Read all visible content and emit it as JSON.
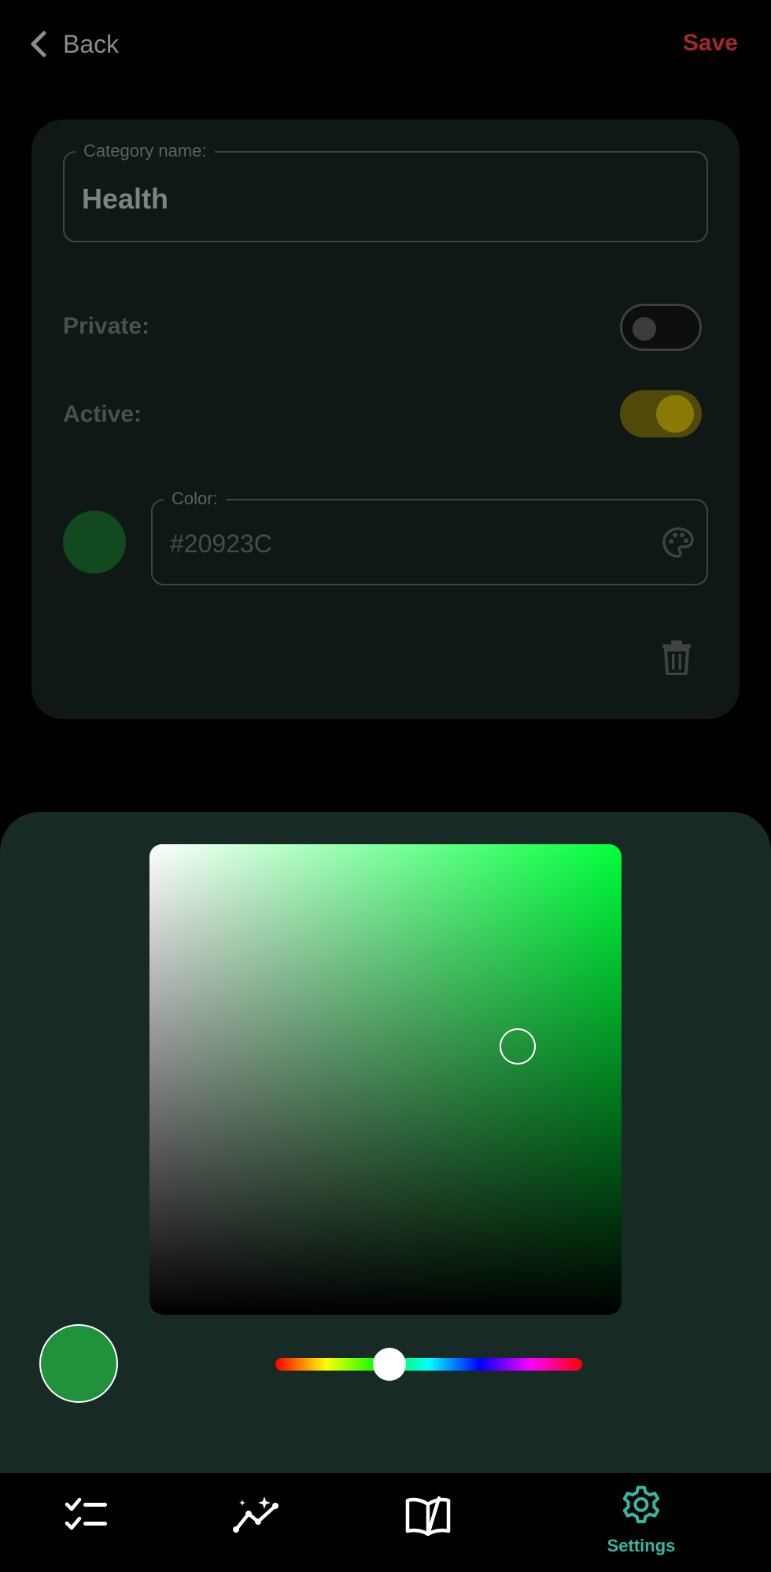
{
  "header": {
    "back_label": "Back",
    "save_label": "Save"
  },
  "form": {
    "name_label": "Category name:",
    "name_value": "Health",
    "private_label": "Private:",
    "private_on": false,
    "active_label": "Active:",
    "active_on": true,
    "color_label": "Color:",
    "color_value": "#20923C"
  },
  "picker": {
    "hue_degrees": 134,
    "saturation": 0.78,
    "value": 0.57,
    "preview_color": "#20923C"
  },
  "nav": {
    "items": [
      {
        "icon": "tasks-checklist-icon",
        "label": ""
      },
      {
        "icon": "stats-chart-icon",
        "label": ""
      },
      {
        "icon": "journal-book-icon",
        "label": ""
      },
      {
        "icon": "settings-gear-icon",
        "label": "Settings",
        "active": true
      }
    ],
    "settings_label": "Settings"
  },
  "colors": {
    "accent": "#35B7A1",
    "save": "#A22828",
    "sheet": "#172A26"
  }
}
